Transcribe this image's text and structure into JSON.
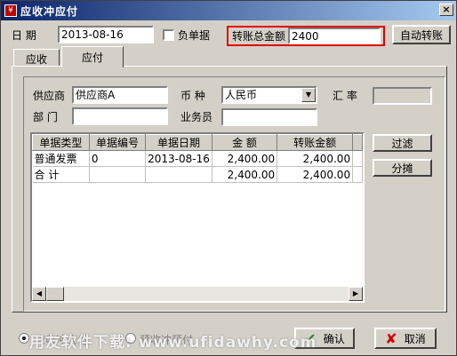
{
  "window": {
    "title": "应收冲应付",
    "close_glyph": "×",
    "icon_glyph": "¥"
  },
  "header": {
    "date_label": "日  期",
    "date_value": "2013-08-16",
    "negative_label": "负单据",
    "total_label": "转账总金额",
    "total_value": "2400",
    "auto_button": "自动转账"
  },
  "tabs": [
    {
      "label": "应收",
      "active": false
    },
    {
      "label": "应付",
      "active": true
    }
  ],
  "form": {
    "supplier_label": "供应商",
    "supplier_value": "供应商A",
    "currency_label": "币  种",
    "currency_value": "人民币",
    "rate_label": "汇  率",
    "rate_value": "",
    "dept_label": "部  门",
    "dept_value": "",
    "staff_label": "业务员",
    "staff_value": ""
  },
  "grid": {
    "columns": [
      "单据类型",
      "单据编号",
      "单据日期",
      "金   额",
      "转账金额"
    ],
    "rows": [
      [
        "普通发票",
        "0",
        "2013-08-16",
        "2,400.00",
        "2,400.00"
      ],
      [
        "合  计",
        "",
        "",
        "2,400.00",
        "2,400.00"
      ]
    ]
  },
  "side_buttons": {
    "filter": "过滤",
    "split": "分摊"
  },
  "footer": {
    "radio1": "应收冲应付",
    "radio2": "预收冲预付",
    "ok": "确认",
    "cancel": "取消"
  },
  "watermark": "用友软件下载: www.ufidawhy.com",
  "colors": {
    "highlight": "#e00000",
    "titlebar": "#0a246a",
    "ok_icon": "#2a8a1a",
    "cancel_icon": "#d00000"
  }
}
